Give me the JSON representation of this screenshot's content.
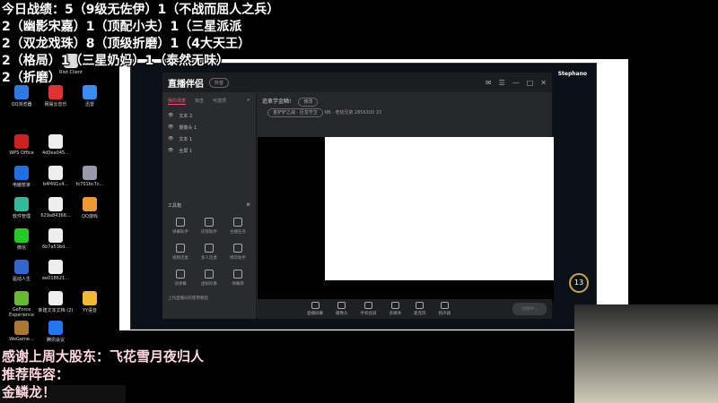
{
  "overlay_top": [
    "今日战绩：5（9级无佐伊）1（不战而屈人之兵）",
    "2（幽影宋嘉）1（顶配小夫）1（三星派派",
    "2（双龙戏珠）8（顶级折磨）1（4大天王）",
    "2（格局）1（三星奶妈）1（泰然无味）",
    "2（折磨）"
  ],
  "overlay_bottom": [
    "感谢上周大股东：飞花雪月夜归人",
    "推荐阵容：",
    "金鳞龙！"
  ],
  "desktop_icons": [
    {
      "label": "Riot Client",
      "color": "#ddd"
    },
    {
      "label": "QQ浏览器",
      "color": "#2a7be4"
    },
    {
      "label": "网易云音乐",
      "color": "#d33"
    },
    {
      "label": "迅雷",
      "color": "#3a8ef0"
    },
    {
      "label": "WPS Office",
      "color": "#c22"
    },
    {
      "label": "4d0ea045...",
      "color": "#eee"
    },
    {
      "label": "电脑管家",
      "color": "#1e6fe0"
    },
    {
      "label": "b4f491c4...",
      "color": "#eee"
    },
    {
      "label": "fc701bc7c...",
      "color": "#99a"
    },
    {
      "label": "软件管理",
      "color": "#3b9"
    },
    {
      "label": "629a84366...",
      "color": "#eee"
    },
    {
      "label": "QQ游戏",
      "color": "#e93"
    },
    {
      "label": "微信",
      "color": "#2c2"
    },
    {
      "label": "6b7a53bd...",
      "color": "#eee"
    },
    {
      "label": "驱动人生",
      "color": "#36c"
    },
    {
      "label": "ee018621...",
      "color": "#eee"
    },
    {
      "label": "GeForce Experience",
      "color": "#6b3"
    },
    {
      "label": "新建文本文档 (2)",
      "color": "#eee"
    },
    {
      "label": "YY语音",
      "color": "#eb3"
    },
    {
      "label": "WeGame...",
      "color": "#a73"
    },
    {
      "label": "腾讯会议",
      "color": "#27e"
    }
  ],
  "lol": {
    "player": "Stephano",
    "level_badge": "13"
  },
  "app": {
    "title": "直播伴侣",
    "pill": "抖音",
    "tabs": [
      "我的场景",
      "双击",
      "可选项"
    ],
    "sources": [
      "文本 2",
      "摄像头 1",
      "文本 1",
      "全屏 1"
    ],
    "tools_title": "工具箱",
    "tools": [
      "弹幕助手",
      "房管助手",
      "主播任务",
      "视频连麦",
      "多人连麦",
      "博弈助手",
      "读弹幕",
      "虚拟形象",
      "弹幕库"
    ],
    "notice": "上热直播间的使用教程",
    "room_title": "追車学金鳞!",
    "edit": "修改",
    "category": "金铲铲之战 · 巨龙守卫",
    "room_info": "NB · 老班兄弟",
    "viewers": "2856300",
    "likes": "20",
    "bottom": [
      "直播屏幕",
      "摄像头",
      "手机投屏",
      "多媒体",
      "麦克风",
      "扬声器"
    ],
    "start": "连接中..."
  }
}
